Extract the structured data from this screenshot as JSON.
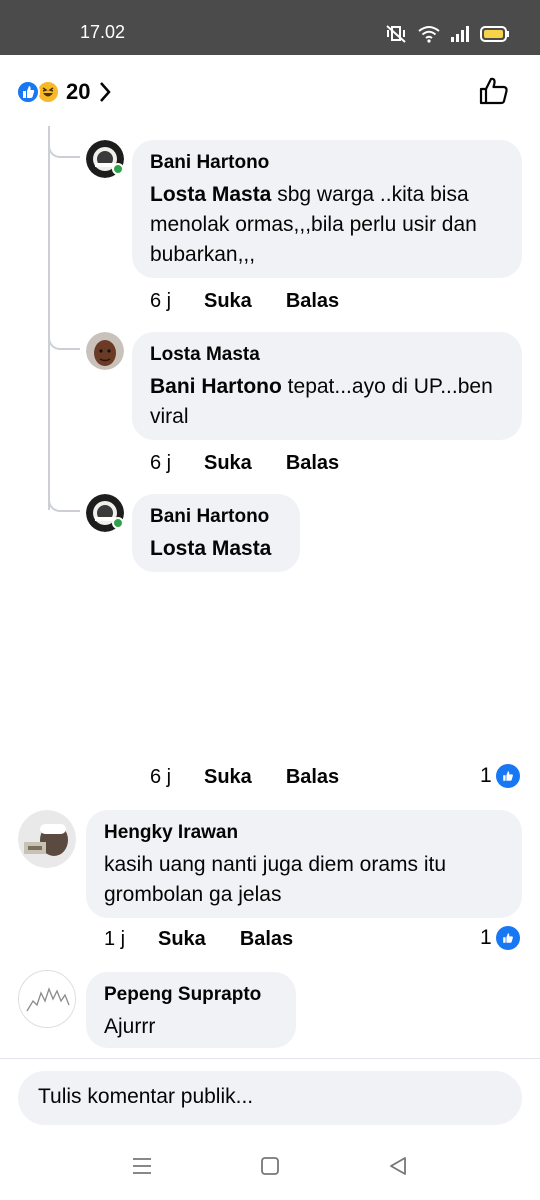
{
  "status_bar": {
    "time": "17.02"
  },
  "header": {
    "reaction_count": "20"
  },
  "replies": [
    {
      "name": "Bani Hartono",
      "tag": "Losta Masta",
      "text": " sbg warga ..kita bisa menolak ormas,,,bila perlu usir dan bubarkan,,,",
      "time": "6 j",
      "like": "Suka",
      "reply": "Balas"
    },
    {
      "name": "Losta Masta",
      "tag": "Bani Hartono",
      "text": " tepat...ayo di UP...ben viral",
      "time": "6 j",
      "like": "Suka",
      "reply": "Balas"
    },
    {
      "name": "Bani Hartono",
      "tag": "Losta Masta",
      "text": "",
      "time": "6 j",
      "like": "Suka",
      "reply": "Balas",
      "likes": "1"
    }
  ],
  "comments": [
    {
      "name": "Hengky Irawan",
      "text": "kasih uang nanti juga diem orams itu grombolan ga jelas",
      "time": "1 j",
      "like": "Suka",
      "reply": "Balas",
      "likes": "1"
    },
    {
      "name": "Pepeng Suprapto",
      "text": "Ajurrr"
    }
  ],
  "composer": {
    "placeholder": "Tulis komentar publik..."
  },
  "icons": {
    "like_reaction": "like-reaction-icon",
    "haha_reaction": "haha-reaction-icon",
    "chevron": "chevron-right-icon",
    "like_button": "thumbs-up-outline-icon",
    "nav_menu": "menu-icon",
    "nav_home": "home-square-icon",
    "nav_back": "back-triangle-icon"
  },
  "colors": {
    "accent": "#1877f2",
    "bubble": "#f0f2f5",
    "online": "#31a24c",
    "status_bar": "#4b4b4b"
  }
}
